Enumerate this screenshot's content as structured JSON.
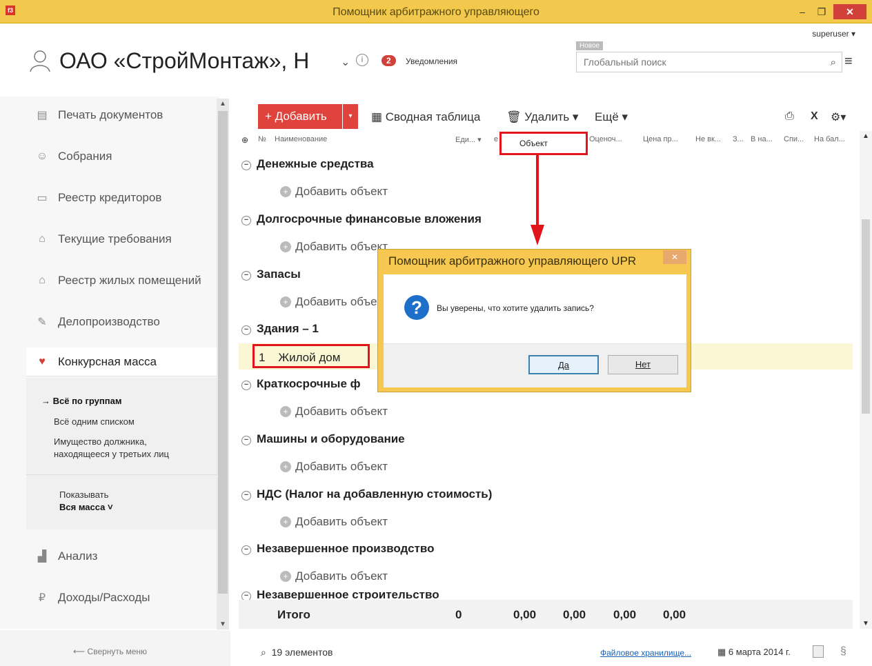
{
  "window": {
    "title": "Помощник арбитражного управляющего",
    "app_icon": "f3",
    "minimize": "–",
    "maximize": "❐",
    "close": "✕"
  },
  "header": {
    "user": "superuser ▾",
    "org_title": "ОАО «СтройМонтаж», Н",
    "org_chevron": "⌄",
    "info": "i",
    "notif_count": "2",
    "notif_label": "Уведомления",
    "new_tag": "Новое",
    "search_placeholder": "Глобальный поиск"
  },
  "sidebar": {
    "items": [
      {
        "icon": "document-icon",
        "glyph": "▤",
        "label": "Печать документов"
      },
      {
        "icon": "meeting-icon",
        "glyph": "☺",
        "label": "Собрания"
      },
      {
        "icon": "creditors-icon",
        "glyph": "▭",
        "label": "Реестр кредиторов"
      },
      {
        "icon": "requirements-icon",
        "glyph": "⌂",
        "label": "Текущие требования"
      },
      {
        "icon": "home-icon",
        "glyph": "⌂",
        "label": "Реестр жилых помещений"
      },
      {
        "icon": "paperclip-icon",
        "glyph": "✎",
        "label": "Делопроизводство"
      },
      {
        "icon": "cart-icon",
        "glyph": "♥",
        "label": "Конкурсная масса"
      },
      {
        "icon": "chart-icon",
        "glyph": "▟",
        "label": "Анализ"
      },
      {
        "icon": "ruble-icon",
        "glyph": "₽",
        "label": "Доходы/Расходы"
      }
    ],
    "sub": {
      "all_by_groups": "→ Всё по группам",
      "all_one_list": "Всё одним списком",
      "third_party": "Имущество должника, находящееся у третьих лиц",
      "show_label": "Показывать",
      "show_value": "Вся масса ˅"
    },
    "collapse": "⟵  Свернуть меню"
  },
  "toolbar": {
    "add": "+ Добавить",
    "add_drop": "▾",
    "pivot": "▦ Сводная таблица",
    "delete": "🗑 Удалить ▾",
    "more": "Ещё ▾",
    "print": "⎙",
    "excel": "X",
    "settings": "⚙▾"
  },
  "table": {
    "columns": [
      "№",
      "Наименование",
      "Еди... ▾",
      "е",
      "Оценоч...",
      "Цена пр...",
      "Не вк...",
      "З...",
      "В на...",
      "Спи...",
      "На бал..."
    ],
    "column_popup": "Объект",
    "add_object": "Добавить объект",
    "groups": [
      "Денежные средства",
      "Долгосрочные финансовые вложения",
      "Запасы",
      "Здания – 1",
      "Краткосрочные ф",
      "Машины и оборудование",
      "НДС (Налог на добавленную стоимость)",
      "Незавершенное производство",
      "Незавершенное строительство"
    ],
    "selected_row": {
      "num": "1",
      "name": "Жилой дом"
    },
    "totals": {
      "label": "Итого",
      "count": "0",
      "v1": "0,00",
      "v2": "0,00",
      "v3": "0,00",
      "v4": "0,00"
    }
  },
  "dialog": {
    "title": "Помощник арбитражного управляющего UPR",
    "close": "✕",
    "message": "Вы уверены, что хотите удалить запись?",
    "yes": "Да",
    "no": "Нет"
  },
  "footer": {
    "count": "19 элементов",
    "file_storage": "Файловое хранилище...",
    "date": "6 марта 2014 г.",
    "section": "§"
  }
}
